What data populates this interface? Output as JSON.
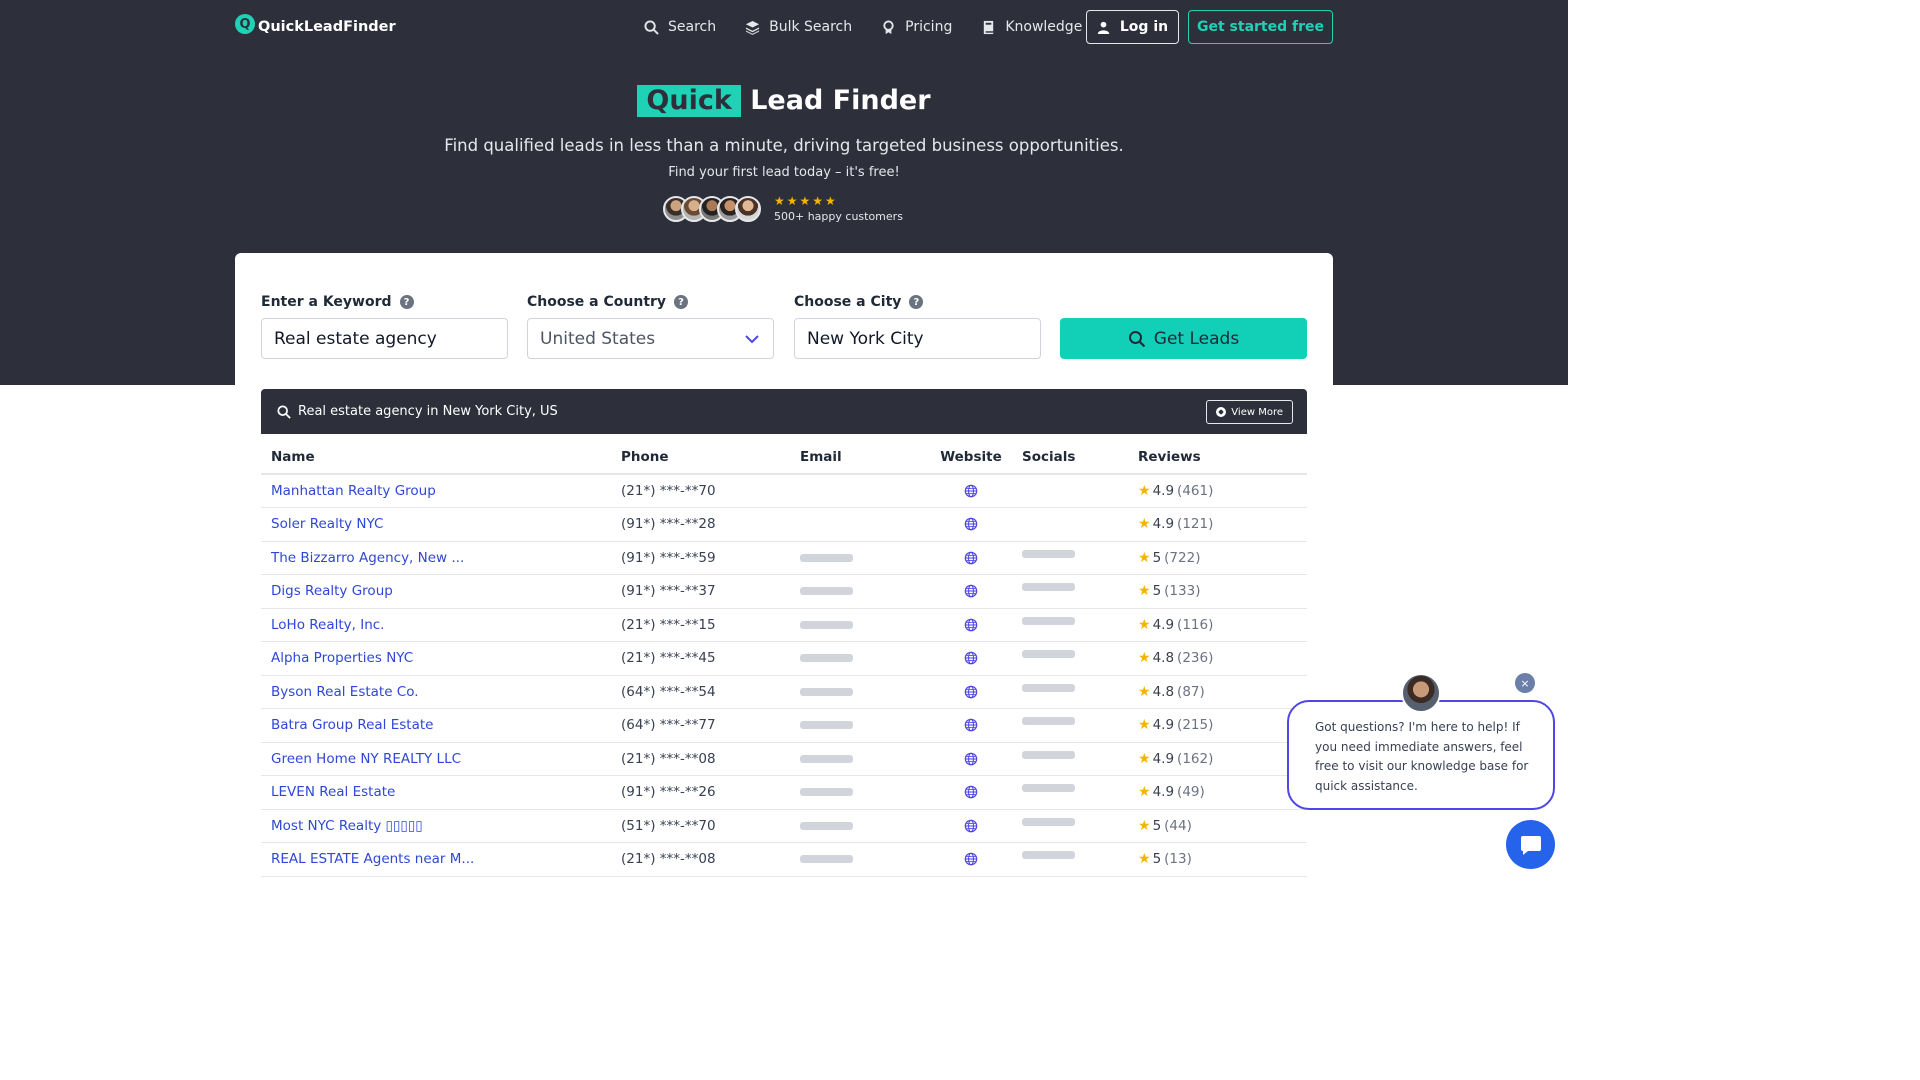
{
  "brand": {
    "name": "QuickLeadFinder",
    "logo_letter": "Q",
    "accent": "#1fd1b5",
    "dark": "#2d303b"
  },
  "nav": {
    "search": "Search",
    "bulk_search": "Bulk Search",
    "pricing": "Pricing",
    "knowledge": "Knowledge",
    "login": "Log in",
    "get_started": "Get started free"
  },
  "hero": {
    "title_highlight": "Quick",
    "title_rest": "Lead Finder",
    "subtitle": "Find qualified leads in less than a minute, driving targeted business opportunities.",
    "subtitle2": "Find your first lead today – it's free!",
    "stars": "★★★★★",
    "happy_customers": "500+ happy customers"
  },
  "search_form": {
    "keyword_label": "Enter a Keyword",
    "keyword_value": "Real estate agency",
    "country_label": "Choose a Country",
    "country_value": "United States",
    "city_label": "Choose a City",
    "city_value": "New York City",
    "help_glyph": "?",
    "submit_label": "Get Leads"
  },
  "results": {
    "heading": "Real estate agency in New York City, US",
    "view_more": "View More",
    "columns": [
      "Name",
      "Phone",
      "Email",
      "Website",
      "Socials",
      "Reviews"
    ],
    "rows": [
      {
        "name": "Manhattan Realty Group",
        "phone": "(21*) ***-**70",
        "email_hidden": false,
        "socials_hidden": false,
        "rating": "4.9",
        "count": "(461)"
      },
      {
        "name": "Soler Realty NYC",
        "phone": "(91*) ***-**28",
        "email_hidden": false,
        "socials_hidden": false,
        "rating": "4.9",
        "count": "(121)"
      },
      {
        "name": "The Bizzarro Agency, New ...",
        "phone": "(91*) ***-**59",
        "email_hidden": true,
        "socials_hidden": true,
        "rating": "5",
        "count": "(722)"
      },
      {
        "name": "Digs Realty Group",
        "phone": "(91*) ***-**37",
        "email_hidden": true,
        "socials_hidden": true,
        "rating": "5",
        "count": "(133)"
      },
      {
        "name": "LoHo Realty, Inc.",
        "phone": "(21*) ***-**15",
        "email_hidden": true,
        "socials_hidden": true,
        "rating": "4.9",
        "count": "(116)"
      },
      {
        "name": "Alpha Properties NYC",
        "phone": "(21*) ***-**45",
        "email_hidden": true,
        "socials_hidden": true,
        "rating": "4.8",
        "count": "(236)"
      },
      {
        "name": "Byson Real Estate Co.",
        "phone": "(64*) ***-**54",
        "email_hidden": true,
        "socials_hidden": true,
        "rating": "4.8",
        "count": "(87)"
      },
      {
        "name": "Batra Group Real Estate",
        "phone": "(64*) ***-**77",
        "email_hidden": true,
        "socials_hidden": true,
        "rating": "4.9",
        "count": "(215)"
      },
      {
        "name": "Green Home NY REALTY LLC",
        "phone": "(21*) ***-**08",
        "email_hidden": true,
        "socials_hidden": true,
        "rating": "4.9",
        "count": "(162)"
      },
      {
        "name": "LEVEN Real Estate",
        "phone": "(91*) ***-**26",
        "email_hidden": true,
        "socials_hidden": true,
        "rating": "4.9",
        "count": "(49)"
      },
      {
        "name": "Most NYC Realty ▯▯▯▯▯",
        "phone": "(51*) ***-**70",
        "email_hidden": true,
        "socials_hidden": true,
        "rating": "5",
        "count": "(44)"
      },
      {
        "name": "REAL ESTATE Agents near M...",
        "phone": "(21*) ***-**08",
        "email_hidden": true,
        "socials_hidden": true,
        "rating": "5",
        "count": "(13)"
      }
    ]
  },
  "chat": {
    "message": "Got questions? I'm here to help! If you need immediate answers, feel free to visit our knowledge base for quick assistance.",
    "close_glyph": "×"
  }
}
